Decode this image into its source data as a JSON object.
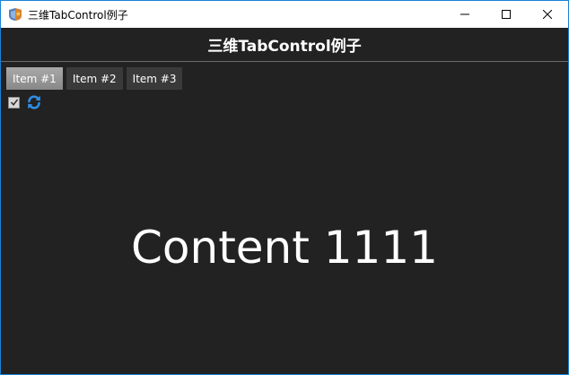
{
  "window": {
    "title": "三维TabControl例子",
    "accent_color": "#1883d7"
  },
  "header": {
    "title": "三维TabControl例子"
  },
  "tabs": [
    {
      "label": "Item #1",
      "selected": true
    },
    {
      "label": "Item #2",
      "selected": false
    },
    {
      "label": "Item #3",
      "selected": false
    }
  ],
  "toolbar": {
    "checkbox_checked": true,
    "refresh_icon": "refresh-icon"
  },
  "content": {
    "text": "Content 1111"
  },
  "colors": {
    "background": "#222222",
    "tab_active": "#999999",
    "tab_inactive": "#3a3a3a",
    "refresh_icon": "#2f8fe8"
  }
}
